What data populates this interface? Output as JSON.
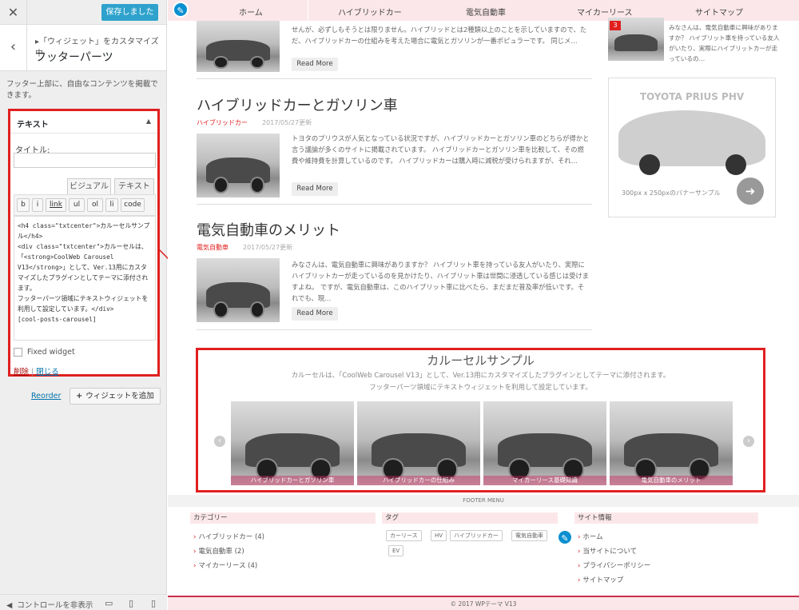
{
  "customizer": {
    "close_icon": "✕",
    "save_label": "保存しました",
    "back_icon": "‹",
    "breadcrumb": "▸「ウィジェット」をカスタマイズ中",
    "section_title": "フッターパーツ",
    "description": "フッター上部に、自由なコンテンツを掲載できます。",
    "widget": {
      "header": "テキスト",
      "caret": "▲",
      "title_label": "タイトル:",
      "title_value": "",
      "tab_visual": "ビジュアル",
      "tab_text": "テキスト",
      "quicktags": [
        "b",
        "i",
        "link",
        "ul",
        "ol",
        "li",
        "code"
      ],
      "content": "<h4 class=\"txtcenter\">カルーセルサンプル</h4>\n<div class=\"txtcenter\">カルーセルは、「<strong>CoolWeb Carousel V13</strong>」として、Ver.13用にカスタマイズしたプラグインとしてテーマに添付されます。\nフッターパーツ領域にテキストウィジェットを利用して設定しています。</div>\n[cool-posts-carousel]",
      "fixed_label": "Fixed widget",
      "delete_label": "削除",
      "separator": " | ",
      "close_label": "閉じる"
    },
    "reorder_label": "Reorder",
    "add_widget_label": "ウィジェットを追加",
    "add_icon": "+",
    "hide_controls": "コントロールを非表示",
    "hide_icon": "◀",
    "device_icons": [
      "desktop-icon",
      "tablet-icon",
      "mobile-icon"
    ]
  },
  "nav": {
    "items": [
      "ホーム",
      "ハイブリッドカー",
      "電気自動車",
      "マイカーリース",
      "サイトマップ"
    ]
  },
  "posts": [
    {
      "excerpt": "せんが、必ずしもそうとは限りません。ハイブリッドとは2種類以上のことを示していますので、ただ、ハイブリッドカーの仕組みを考えた場合に電気とガソリンが一番ポピュラーです。 同じメ…",
      "readmore": "Read More"
    },
    {
      "title": "ハイブリッドカーとガソリン車",
      "category": "ハイブリッドカー",
      "date": "2017/05/27更新",
      "excerpt": "トヨタのプリウスが人気となっている状況ですが、ハイブリッドカーとガソリン車のどちらが得かと言う議論が多くのサイトに掲載されています。 ハイブリッドカーとガソリン車を比較して、その燃費や維持費を計算しているのです。 ハイブリッドカーは購入時に減税が受けられますが、それ…",
      "readmore": "Read More"
    },
    {
      "title": "電気自動車のメリット",
      "category": "電気自動車",
      "date": "2017/05/27更新",
      "excerpt": "みなさんは、電気自動車に興味がありますか？ ハイブリット車を持っている友人がいたり、実際にハイブリットカーが走っているのを見かけたり、ハイブリット車は世間に浸透している感じは受けますよね。 ですが、電気自動車は、このハイブリット車に比べたら、まだまだ普及率が低いです。それでも、現…",
      "readmore": "Read More"
    }
  ],
  "side_widget": {
    "badge": "3",
    "excerpt": "みなさんは、電気自動車に興味がありますか？ ハイブリット車を持っている友人がいたり、実際にハイブリットカーが走っているの…"
  },
  "banner": {
    "title": "TOYOTA PRIUS PHV",
    "caption": "300px x 250pxのバナーサンプル",
    "arrow_icon": "➜"
  },
  "carousel": {
    "title": "カルーセルサンプル",
    "line1": "カルーセルは、「CoolWeb Carousel V13」として、Ver.13用にカスタマイズしたプラグインとしてテーマに添付されます。",
    "line2": "フッターパーツ領域にテキストウィジェットを利用して設定しています。",
    "slides": [
      "ハイブリッドカーとガソリン車",
      "ハイブリッドカーの仕組み",
      "マイカーリース基礎知識",
      "電気自動車のメリット"
    ],
    "prev_icon": "‹",
    "next_icon": "›"
  },
  "footer": {
    "menu_label": "FOOTER MENU",
    "categories_head": "カテゴリー",
    "categories": [
      "ハイブリッドカー (4)",
      "電気自動車 (2)",
      "マイカーリース (4)"
    ],
    "tags_head": "タグ",
    "tags": [
      "カーリース",
      "HV",
      "ハイブリッドカー",
      "電気自動車",
      "EV"
    ],
    "site_head": "サイト情報",
    "site_links": [
      "ホーム",
      "当サイトについて",
      "プライバシーポリシー",
      "サイトマップ"
    ],
    "copyright": "© 2017 WPテーマ V13",
    "chevron": "›"
  },
  "colors": {
    "accent_red": "#e0201f",
    "wp_blue": "#2ea2cc",
    "nav_pink": "#fbe7ea"
  }
}
